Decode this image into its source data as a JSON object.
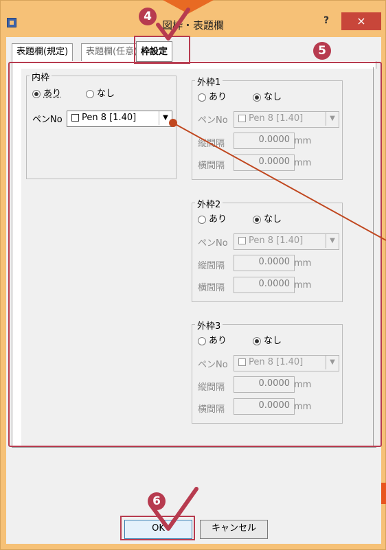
{
  "window": {
    "title": "図枠・表題欄",
    "help_label": "?",
    "close_label": "×"
  },
  "tabs": [
    {
      "label": "表題欄(規定)"
    },
    {
      "label": "表題欄(任意)"
    },
    {
      "label": "枠設定"
    }
  ],
  "inner_frame": {
    "title": "内枠",
    "option_yes": "あり",
    "option_no": "なし",
    "selected": "あり",
    "pen_label": "ペンNo",
    "pen_value": "Pen 8    [1.40]"
  },
  "outer_frames": [
    {
      "title": "外枠1",
      "option_yes": "あり",
      "option_no": "なし",
      "selected": "なし",
      "pen_label": "ペンNo",
      "pen_value": "Pen 8    [1.40]",
      "vert_label": "縦間隔",
      "vert_value": "0.0000",
      "horiz_label": "横間隔",
      "horiz_value": "0.0000",
      "unit": "mm"
    },
    {
      "title": "外枠2",
      "option_yes": "あり",
      "option_no": "なし",
      "selected": "なし",
      "pen_label": "ペンNo",
      "pen_value": "Pen 8    [1.40]",
      "vert_label": "縦間隔",
      "vert_value": "0.0000",
      "horiz_label": "横間隔",
      "horiz_value": "0.0000",
      "unit": "mm"
    },
    {
      "title": "外枠3",
      "option_yes": "あり",
      "option_no": "なし",
      "selected": "なし",
      "pen_label": "ペンNo",
      "pen_value": "Pen 8    [1.40]",
      "vert_label": "縦間隔",
      "vert_value": "0.0000",
      "horiz_label": "横間隔",
      "horiz_value": "0.0000",
      "unit": "mm"
    }
  ],
  "buttons": {
    "ok": "OK",
    "cancel": "キャンセル"
  },
  "annotations": {
    "step4": "4",
    "step5": "5",
    "step6": "6"
  },
  "colors": {
    "accent": "#b73b4f",
    "frame": "#f6c177",
    "arrow": "#e86a23"
  }
}
